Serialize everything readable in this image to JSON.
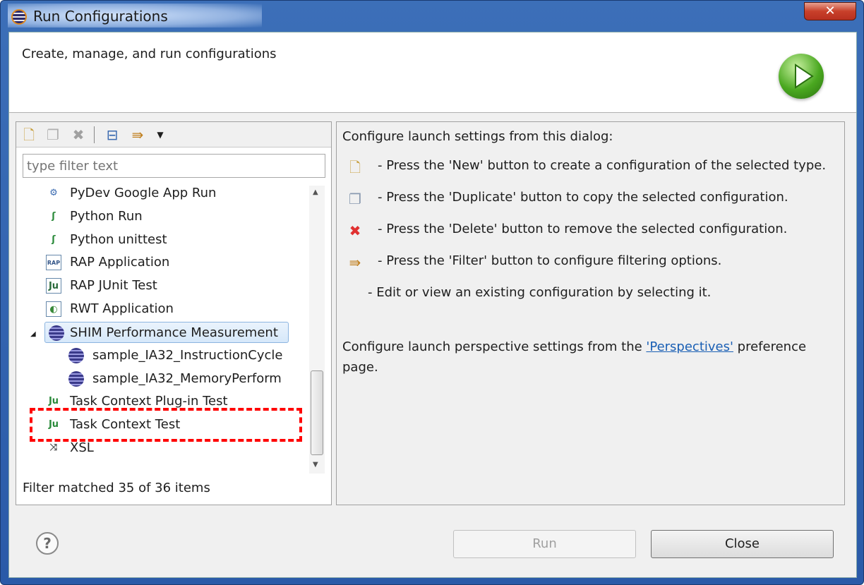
{
  "window": {
    "title": "Run Configurations",
    "close_icon": "close-icon"
  },
  "header": {
    "description": "Create, manage, and run configurations",
    "icon": "run-icon"
  },
  "left": {
    "toolbar": {
      "new": "new-config-icon",
      "duplicate": "duplicate-icon",
      "delete": "delete-icon",
      "collapse": "collapse-all-icon",
      "filter": "filter-icon",
      "menu": "view-menu-icon"
    },
    "filter_placeholder": "type filter text",
    "tree": [
      {
        "label": "PyDev Google App Run",
        "level": 0
      },
      {
        "label": "Python Run",
        "level": 0
      },
      {
        "label": "Python unittest",
        "level": 0
      },
      {
        "label": "RAP Application",
        "level": 0
      },
      {
        "label": "RAP JUnit Test",
        "level": 0
      },
      {
        "label": "RWT Application",
        "level": 0
      },
      {
        "label": "SHIM Performance Measurement",
        "level": 0,
        "expanded": true,
        "selected": true
      },
      {
        "label": "sample_IA32_InstructionCycle",
        "level": 1
      },
      {
        "label": "sample_IA32_MemoryPerform",
        "level": 1
      },
      {
        "label": "Task Context Plug-in Test",
        "level": 0
      },
      {
        "label": "Task Context Test",
        "level": 0
      },
      {
        "label": "XSL",
        "level": 0
      }
    ],
    "status": "Filter matched 35 of 36 items"
  },
  "right": {
    "intro": "Configure launch settings from this dialog:",
    "items": [
      "- Press the 'New' button to create a configuration of the selected type.",
      "- Press the 'Duplicate' button to copy the selected configuration.",
      "- Press the 'Delete' button to remove the selected configuration.",
      "- Press the 'Filter' button to configure filtering options.",
      "- Edit or view an existing configuration by selecting it."
    ],
    "perspective_prefix": "Configure launch perspective settings from the ",
    "perspective_link": "'Perspectives'",
    "perspective_suffix": " preference",
    "perspective_line2": "page."
  },
  "buttons": {
    "run": "Run",
    "close": "Close",
    "run_enabled": false
  }
}
